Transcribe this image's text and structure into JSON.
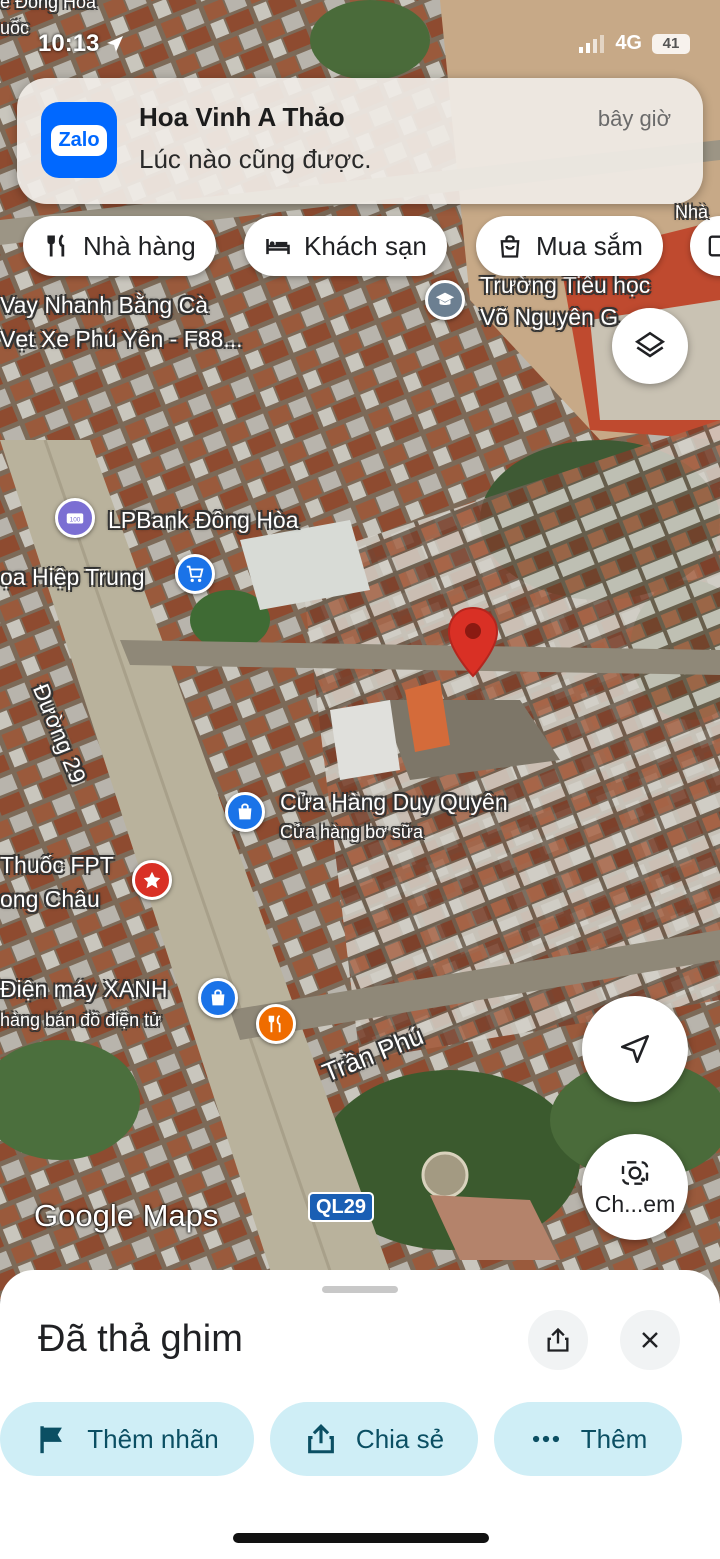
{
  "status_bar": {
    "time": "10:13",
    "network": "4G",
    "battery": "41",
    "overlay_text_1": "e Đông Hòa",
    "overlay_text_2": "uốc"
  },
  "notification": {
    "app_name": "Zalo",
    "sender": "Hoa Vinh A Thảo",
    "message": "Lúc nào cũng được.",
    "time": "bây giờ"
  },
  "chips": [
    {
      "label": "Nhà hàng",
      "icon": "restaurant-icon"
    },
    {
      "label": "Khách sạn",
      "icon": "hotel-icon"
    },
    {
      "label": "Mua sắm",
      "icon": "shopping-bag-icon"
    }
  ],
  "chip_partial_label": "Nhà",
  "map_labels": {
    "school_line1": "Trường Tiểu học",
    "school_line2": "Võ Nguyên G...",
    "loan_line1": "Vay Nhanh Bằng Cà",
    "loan_line2": "Vẹt Xe Phú Yên - F88...",
    "bank": "LPBank Đông Hòa",
    "market": "ọa Hiệp Trung",
    "road_29": "Đường 29",
    "dairy_name": "Cửa Hàng Duy Quyên",
    "dairy_type": "Cửa hàng bơ sữa",
    "pharmacy_line1": "Thuốc FPT",
    "pharmacy_line2": "ong Châu",
    "electronics_name": "Điện máy XANH",
    "electronics_type": "hàng bán đồ điện tử",
    "road_tran_phu": "Trần Phú",
    "road_shield": "QL29",
    "logo": "Google Maps"
  },
  "map_buttons": {
    "streetview_label": "Ch...em"
  },
  "sheet": {
    "title": "Đã thả ghim",
    "actions": [
      {
        "label": "Thêm nhãn",
        "icon": "flag-icon"
      },
      {
        "label": "Chia sẻ",
        "icon": "share-icon"
      },
      {
        "label": "Thêm",
        "icon": "more-icon"
      }
    ]
  },
  "colors": {
    "pin": "#d93025",
    "action_bg": "#cfeef6",
    "action_text": "#0b4f63",
    "zalo_blue": "#0068ff"
  }
}
